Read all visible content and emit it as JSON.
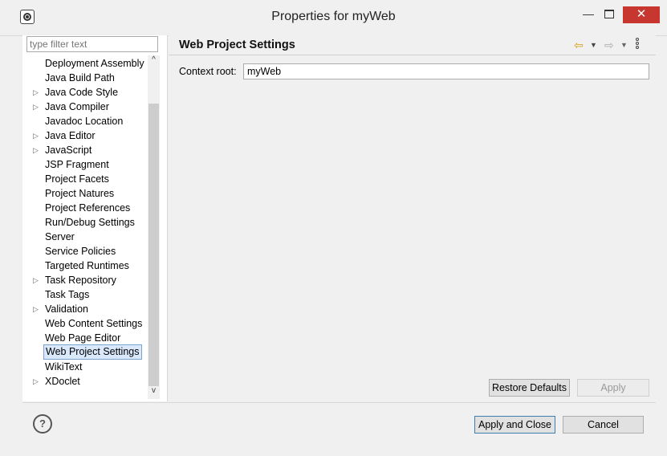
{
  "window": {
    "title": "Properties for myWeb",
    "minimize": "—",
    "close": "✕",
    "app_icon": "eclipse-gear-icon"
  },
  "filter": {
    "placeholder": "type filter text"
  },
  "tree": {
    "items": [
      {
        "label": "Deployment Assembly",
        "expandable": false
      },
      {
        "label": "Java Build Path",
        "expandable": false
      },
      {
        "label": "Java Code Style",
        "expandable": true
      },
      {
        "label": "Java Compiler",
        "expandable": true
      },
      {
        "label": "Javadoc Location",
        "expandable": false
      },
      {
        "label": "Java Editor",
        "expandable": true
      },
      {
        "label": "JavaScript",
        "expandable": true
      },
      {
        "label": "JSP Fragment",
        "expandable": false
      },
      {
        "label": "Project Facets",
        "expandable": false
      },
      {
        "label": "Project Natures",
        "expandable": false
      },
      {
        "label": "Project References",
        "expandable": false
      },
      {
        "label": "Run/Debug Settings",
        "expandable": false
      },
      {
        "label": "Server",
        "expandable": false
      },
      {
        "label": "Service Policies",
        "expandable": false
      },
      {
        "label": "Targeted Runtimes",
        "expandable": false
      },
      {
        "label": "Task Repository",
        "expandable": true
      },
      {
        "label": "Task Tags",
        "expandable": false
      },
      {
        "label": "Validation",
        "expandable": true
      },
      {
        "label": "Web Content Settings",
        "expandable": false
      },
      {
        "label": "Web Page Editor",
        "expandable": false
      },
      {
        "label": "Web Project Settings",
        "expandable": false,
        "selected": true
      },
      {
        "label": "WikiText",
        "expandable": false
      },
      {
        "label": "XDoclet",
        "expandable": true
      }
    ]
  },
  "page": {
    "title": "Web Project Settings",
    "context_root_label": "Context root:",
    "context_root_value": "myWeb",
    "restore_defaults": "Restore Defaults",
    "apply": "Apply"
  },
  "footer": {
    "help": "?",
    "apply_and_close": "Apply and Close",
    "cancel": "Cancel"
  },
  "icons": {
    "back": "⇦",
    "forward": "⇨",
    "dropdown": "▼",
    "expand": "▷",
    "scroll_up": "^",
    "scroll_down": "v"
  },
  "colors": {
    "close_button": "#c7372f",
    "selection_bg": "#d9e8fb",
    "back_arrow": "#d4a017"
  }
}
